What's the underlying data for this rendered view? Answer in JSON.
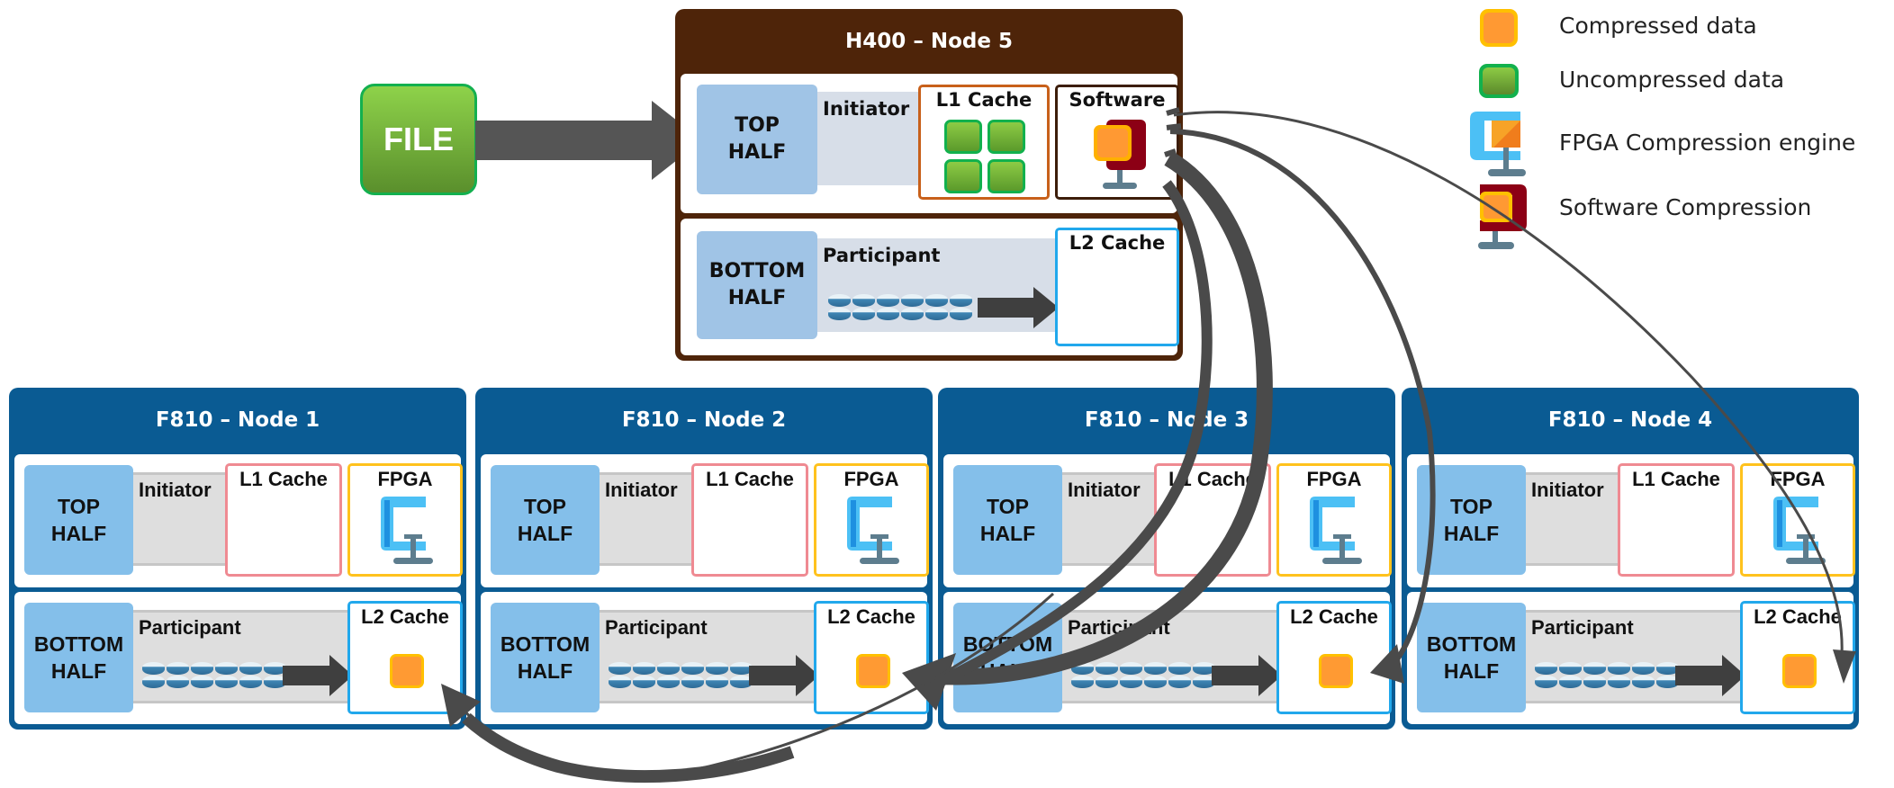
{
  "file": {
    "label": "FILE"
  },
  "h400": {
    "title": "H400 – Node 5",
    "top_half": "TOP\nHALF",
    "bottom_half": "BOTTOM\nHALF",
    "initiator": "Initiator",
    "participant": "Participant",
    "l1_cache": "L1 Cache",
    "software": "Software",
    "l2_cache": "L2 Cache"
  },
  "f810_nodes": [
    {
      "title": "F810 – Node 1"
    },
    {
      "title": "F810 – Node 2"
    },
    {
      "title": "F810 – Node 3"
    },
    {
      "title": "F810 – Node 4"
    }
  ],
  "f810_labels": {
    "top_half": "TOP\nHALF",
    "bottom_half": "BOTTOM\nHALF",
    "initiator": "Initiator",
    "participant": "Participant",
    "l1_cache": "L1 Cache",
    "fpga": "FPGA",
    "l2_cache": "L2 Cache"
  },
  "legend": [
    {
      "icon": "compressed-data-icon",
      "label": "Compressed data"
    },
    {
      "icon": "uncompressed-data-icon",
      "label": "Uncompressed data"
    },
    {
      "icon": "fpga-compression-engine-icon",
      "label": "FPGA Compression engine"
    },
    {
      "icon": "software-compression-icon",
      "label": "Software Compression"
    }
  ],
  "colors": {
    "h400_header": "#4e2409",
    "f810_header": "#0a5b93",
    "compressed": "#ff9a33",
    "uncompressed": "#6fb43a",
    "arrow": "#4a4a4a"
  }
}
